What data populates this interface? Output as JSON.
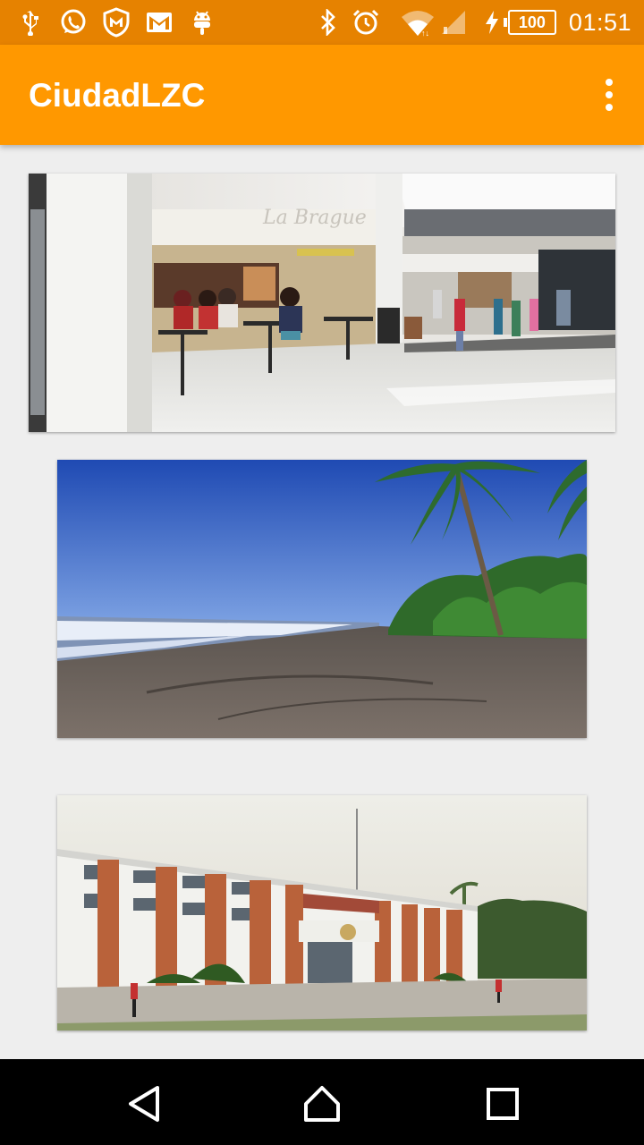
{
  "status_bar": {
    "left_icons": [
      "usb-icon",
      "whatsapp-icon",
      "shield-m-icon",
      "gmail-icon",
      "android-debug-icon"
    ],
    "right_icons": [
      "bluetooth-icon",
      "alarm-icon",
      "wifi-icon",
      "signal-icon",
      "charging-icon"
    ],
    "battery_level": "100",
    "time": "01:51"
  },
  "app_bar": {
    "title": "CiudadLZC",
    "overflow_icon": "more-vert-icon"
  },
  "gallery": {
    "items": [
      {
        "subject": "mall-cafe-photo"
      },
      {
        "subject": "beach-palms-photo"
      },
      {
        "subject": "municipal-building-photo"
      }
    ]
  },
  "nav_bar": {
    "buttons": [
      "back-icon",
      "home-icon",
      "recents-icon"
    ]
  },
  "colors": {
    "status_bar": "#e68200",
    "app_bar": "#ff9800",
    "background": "#eeeeee",
    "nav_bar": "#000000"
  }
}
